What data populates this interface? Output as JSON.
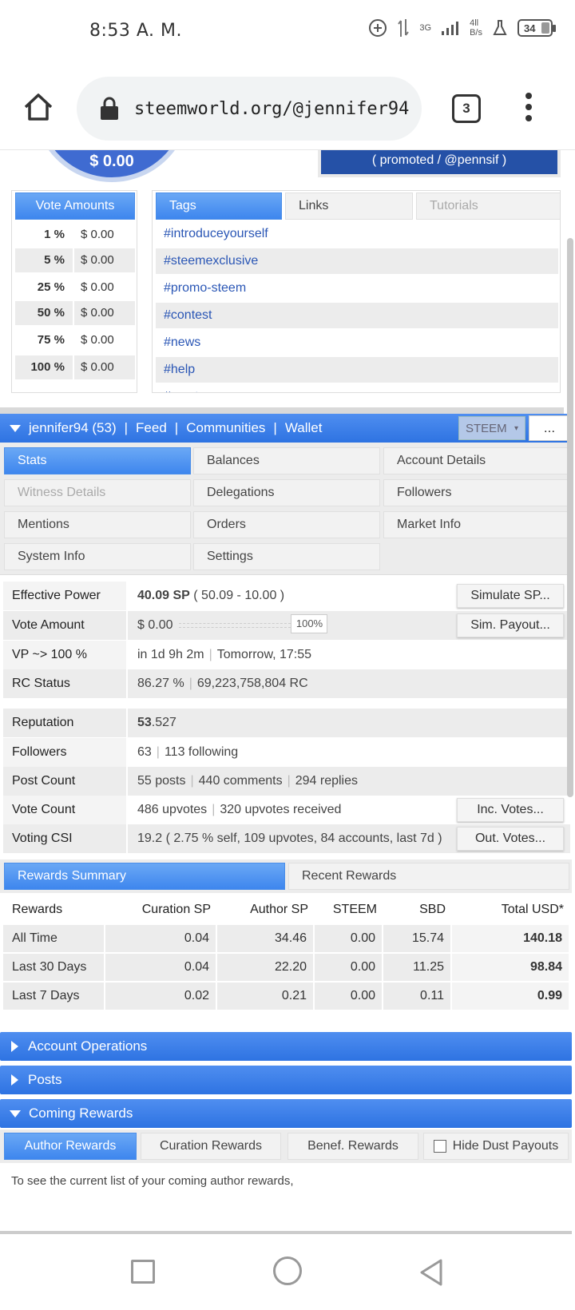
{
  "status": {
    "time": "8:53 A. M.",
    "network": "3G",
    "signal": "4ll",
    "speed": "B/s",
    "battery": "34"
  },
  "browser": {
    "url": "steemworld.org/@jennifer94",
    "tab_count": "3"
  },
  "top": {
    "circle_value": "$ 0.00",
    "promo_text": "( promoted / @pennsif )"
  },
  "vote_amounts": {
    "header": "Vote Amounts",
    "rows": [
      {
        "pct": "1 %",
        "amt": "$ 0.00"
      },
      {
        "pct": "5 %",
        "amt": "$ 0.00"
      },
      {
        "pct": "25 %",
        "amt": "$ 0.00"
      },
      {
        "pct": "50 %",
        "amt": "$ 0.00"
      },
      {
        "pct": "75 %",
        "amt": "$ 0.00"
      },
      {
        "pct": "100 %",
        "amt": "$ 0.00"
      }
    ]
  },
  "tags_panel": {
    "tabs": [
      "Tags",
      "Links",
      "Tutorials"
    ],
    "items": [
      "#introduceyourself",
      "#steemexclusive",
      "#promo-steem",
      "#contest",
      "#news",
      "#help",
      "#crypto"
    ]
  },
  "account_bar": {
    "user": "jennifer94 (53)",
    "links": [
      "Feed",
      "Communities",
      "Wallet"
    ],
    "currency": "STEEM",
    "more": "..."
  },
  "nav": {
    "items": [
      "Stats",
      "Balances",
      "Account Details",
      "Witness Details",
      "Delegations",
      "Followers",
      "Mentions",
      "Orders",
      "Market Info",
      "System Info",
      "Settings"
    ]
  },
  "stats": {
    "effective_power": {
      "label": "Effective Power",
      "sp": "40.09 SP",
      "detail": "( 50.09 - 10.00 )",
      "button": "Simulate SP..."
    },
    "vote_amount": {
      "label": "Vote Amount",
      "value": "$ 0.00",
      "pct": "100%",
      "button": "Sim. Payout..."
    },
    "vp": {
      "label": "VP ~> 100 %",
      "value": "in 1d 9h 2m",
      "when": "Tomorrow, 17:55"
    },
    "rc": {
      "label": "RC Status",
      "pct": "86.27 %",
      "value": "69,223,758,804 RC"
    },
    "reputation": {
      "label": "Reputation",
      "int": "53",
      "dec": ".527"
    },
    "followers": {
      "label": "Followers",
      "count": "63",
      "following": "113 following"
    },
    "post_count": {
      "label": "Post Count",
      "posts": "55 posts",
      "comments": "440 comments",
      "replies": "294 replies"
    },
    "vote_count": {
      "label": "Vote Count",
      "upvotes": "486 upvotes",
      "received": "320 upvotes received",
      "button": "Inc. Votes..."
    },
    "voting_csi": {
      "label": "Voting CSI",
      "value": "19.2 ( 2.75 % self, 109 upvotes, 84 accounts, last 7d )",
      "button": "Out. Votes..."
    }
  },
  "rewards": {
    "tabs": [
      "Rewards Summary",
      "Recent Rewards"
    ],
    "columns": [
      "Rewards",
      "Curation SP",
      "Author SP",
      "STEEM",
      "SBD",
      "Total USD*"
    ],
    "rows": [
      [
        "All Time",
        "0.04",
        "34.46",
        "0.00",
        "15.74",
        "140.18"
      ],
      [
        "Last 30 Days",
        "0.04",
        "22.20",
        "0.00",
        "11.25",
        "98.84"
      ],
      [
        "Last 7 Days",
        "0.02",
        "0.21",
        "0.00",
        "0.11",
        "0.99"
      ]
    ]
  },
  "sections": {
    "account_operations": "Account Operations",
    "posts": "Posts",
    "coming_rewards": "Coming Rewards"
  },
  "coming_rewards": {
    "tabs": [
      "Author Rewards",
      "Curation Rewards",
      "Benef. Rewards"
    ],
    "hide_dust": "Hide Dust Payouts",
    "note": "To see the current list of your coming author rewards,"
  }
}
